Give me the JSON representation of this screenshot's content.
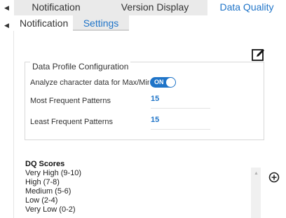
{
  "tabs": {
    "outer": [
      "Notification",
      "Version Display",
      "Data Quality"
    ],
    "outer_active": "Data Quality",
    "inner": [
      "Notification",
      "Settings"
    ],
    "inner_active": "Settings"
  },
  "profile": {
    "legend": "Data Profile Configuration",
    "analyze_label": "Analyze character data for Max/Min values",
    "toggle_text": "ON",
    "most_label": "Most Frequent Patterns",
    "most_value": "15",
    "least_label": "Least Frequent Patterns",
    "least_value": "15"
  },
  "dq": {
    "title": "DQ Scores",
    "items": [
      "Very High (9-10)",
      "High (7-8)",
      "Medium (5-6)",
      "Low (2-4)",
      "Very Low (0-2)"
    ]
  },
  "colors": {
    "accent": "#1f74c8",
    "tab_bg": "#eaeaea"
  },
  "icons": {
    "edit": "edit-pencil-icon",
    "add": "add-circle-icon",
    "scroll": "scroll-up-icon",
    "collapse": "collapse-arrow-icon"
  }
}
